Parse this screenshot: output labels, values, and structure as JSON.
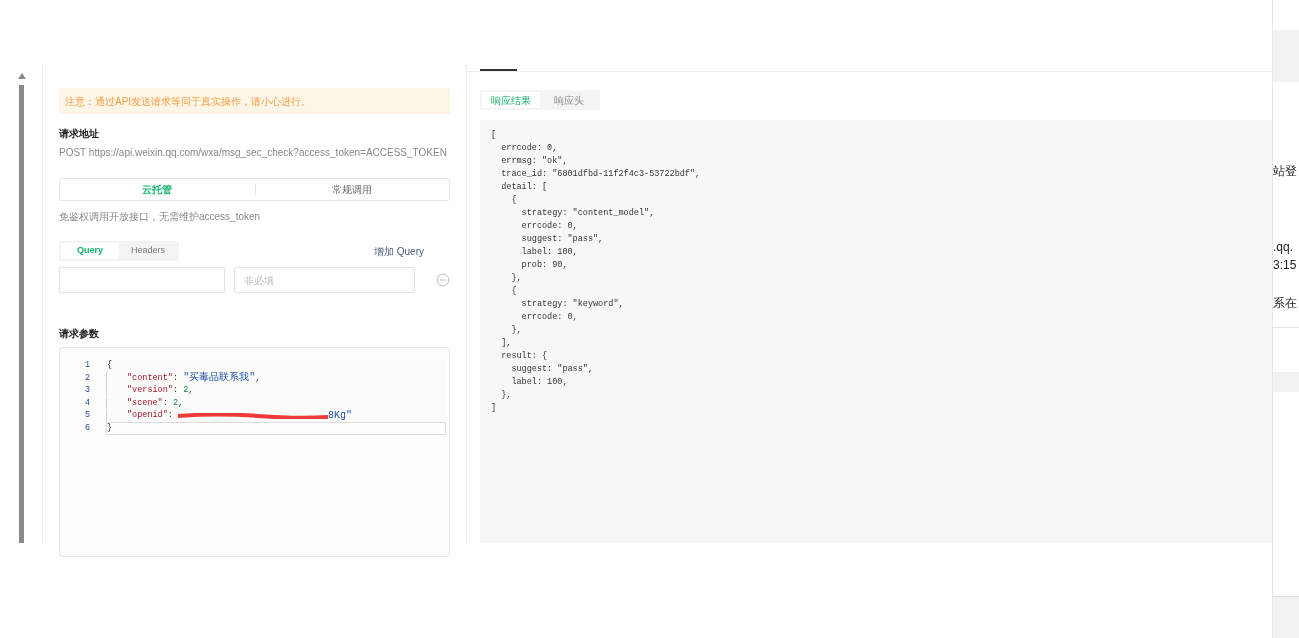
{
  "notice": "注意：通过API发送请求等同于真实操作，请小心进行。",
  "request_url": {
    "label": "请求地址",
    "value": "POST https://api.weixin.qq.com/wxa/msg_sec_check?access_token=ACCESS_TOKEN"
  },
  "call_modes": [
    {
      "label": "云托管",
      "selected": true
    },
    {
      "label": "常规调用",
      "selected": false
    }
  ],
  "call_mode_hint": "免鉴权调用开放接口，无需维护access_token",
  "param_tabs": [
    {
      "label": "Query",
      "selected": true
    },
    {
      "label": "Headers",
      "selected": false
    }
  ],
  "add_query": "增加 Query",
  "query_row": {
    "value_placeholder": "非必填"
  },
  "params": {
    "label": "请求参数",
    "lines": [
      {
        "number": "1",
        "current": false,
        "tokens": [
          {
            "kind": "punct",
            "text": "{"
          }
        ]
      },
      {
        "number": "2",
        "current": false,
        "tokens": [
          {
            "kind": "key",
            "text": "\"content\""
          },
          {
            "kind": "punct",
            "text": ": "
          },
          {
            "kind": "string",
            "text": "\"买毒品联系我\""
          },
          {
            "kind": "punct",
            "text": ","
          }
        ]
      },
      {
        "number": "3",
        "current": false,
        "tokens": [
          {
            "kind": "key",
            "text": "\"version\""
          },
          {
            "kind": "punct",
            "text": ": "
          },
          {
            "kind": "number",
            "text": "2"
          },
          {
            "kind": "punct",
            "text": ","
          }
        ]
      },
      {
        "number": "4",
        "current": false,
        "tokens": [
          {
            "kind": "key",
            "text": "\"scene\""
          },
          {
            "kind": "punct",
            "text": ": "
          },
          {
            "kind": "number",
            "text": "2"
          },
          {
            "kind": "punct",
            "text": ","
          }
        ]
      },
      {
        "number": "5",
        "current": false,
        "tokens": [
          {
            "kind": "key",
            "text": "\"openid\""
          },
          {
            "kind": "punct",
            "text": ": "
          },
          {
            "kind": "redacted"
          },
          {
            "kind": "string",
            "text": "8Kg\""
          }
        ]
      },
      {
        "number": "6",
        "current": true,
        "tokens": [
          {
            "kind": "punct",
            "text": "}"
          }
        ]
      }
    ]
  },
  "response_tabs": [
    {
      "label": "响应结果",
      "selected": true
    },
    {
      "label": "响应头",
      "selected": false
    }
  ],
  "response_lines": [
    "[",
    "  errcode: 0,",
    "  errmsg: \"ok\",",
    "  trace_id: \"6801dfbd-11f2f4c3-53722bdf\",",
    "  detail: [",
    "    {",
    "      strategy: \"content_model\",",
    "      errcode: 0,",
    "      suggest: \"pass\",",
    "      label: 100,",
    "      prob: 90,",
    "    },",
    "    {",
    "      strategy: \"keyword\",",
    "      errcode: 0,",
    "    },",
    "  ],",
    "  result: {",
    "    suggest: \"pass\",",
    "    label: 100,",
    "  },",
    "]"
  ],
  "background_texts": [
    "站登",
    ".qq.",
    "3:15",
    "系在"
  ]
}
